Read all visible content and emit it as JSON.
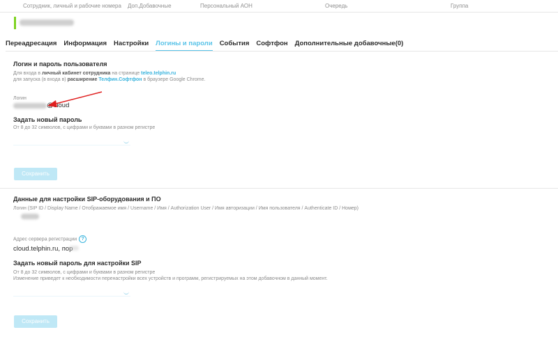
{
  "header": {
    "col1": "Сотрудник, личный и рабочие номера",
    "col2": "Доп.Добавочные",
    "col3": "Персональный АОН",
    "col4": "Очередь",
    "col5": "Группа"
  },
  "tabs": [
    {
      "label": "Переадресация"
    },
    {
      "label": "Информация"
    },
    {
      "label": "Настройки"
    },
    {
      "label": "Логины и пароли",
      "active": true
    },
    {
      "label": "События"
    },
    {
      "label": "Софтфон"
    },
    {
      "label": "Дополнительные добавочные(0)"
    }
  ],
  "login_section": {
    "title": "Логин и пароль пользователя",
    "desc1_a": "Для входа в ",
    "desc1_b": "личный кабинет сотрудника",
    "desc1_c": " на странице ",
    "desc1_link": "teleo.telphin.ru",
    "desc2_a": "для запуска (в входа в) ",
    "desc2_b": "расширение",
    "desc2_link": "Телфин.Софтфон",
    "desc2_c": " в браузере Google Chrome.",
    "login_label": "Логин",
    "login_value": "@cloud",
    "new_pwd_title": "Задать новый пароль",
    "new_pwd_hint": "От 8 до 32 символов, с цифрами и буквами в разном регистре",
    "save_label": "Сохранить"
  },
  "sip_section": {
    "title": "Данные для настройки SIP-оборудования и ПО",
    "login_desc": "Логин (SIP ID / Display Name / Отображаемое имя / Username / Имя / Authorization User / Имя авторизации / Имя пользователя / Authenticate ID / Номер)",
    "server_label": "Адрес сервера регистрации",
    "help_icon": "?",
    "server_value": "cloud.telphin.ru, пор",
    "new_pwd_title": "Задать новый пароль для настройки SIP",
    "hint1": "От 8 до 32 символов, с цифрами и буквами в разном регистре",
    "hint2": "Изменение приведет к необходимости перенастройки всех устройств и программ, регистрируемых на этом добавочном в данный момент.",
    "save_label": "Сохранить"
  },
  "colors": {
    "accent": "#59c3e8",
    "arrow": "#e02020",
    "green_marker": "#7ed321"
  }
}
